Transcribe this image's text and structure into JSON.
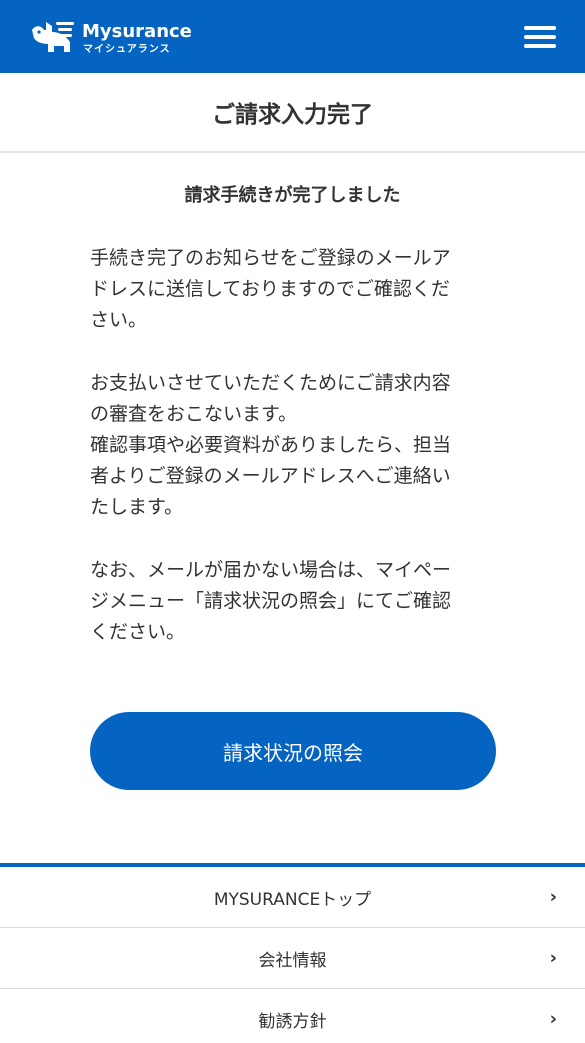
{
  "header": {
    "logo_text": "Mysurance",
    "logo_subtext": "マイシュアランス",
    "menu_icon": "hamburger-menu-icon",
    "brand_color": "#0563c1"
  },
  "page_title": "ご請求入力完了",
  "content": {
    "subheading": "請求手続きが完了しました",
    "paragraph1": "手続き完了のお知らせをご登録のメールア\nドレスに送信しておりますのでご確認くだ\nさい。",
    "paragraph2": "お支払いさせていただくためにご請求内容\nの審査をおこないます。\n確認事項や必要資料がありましたら、担当\n者よりご登録のメールアドレスへご連絡い\nたします。",
    "paragraph3": "なお、メールが届かない場合は、マイペー\nジメニュー「請求状況の照会」にてご確認\nください。",
    "button_label": "請求状況の照会"
  },
  "footer_nav": {
    "items": [
      {
        "label": "MYSURANCEトップ",
        "icon": "chevron-right-icon"
      },
      {
        "label": "会社情報",
        "icon": "chevron-right-icon"
      },
      {
        "label": "勧誘方針",
        "icon": "chevron-right-icon"
      }
    ]
  }
}
